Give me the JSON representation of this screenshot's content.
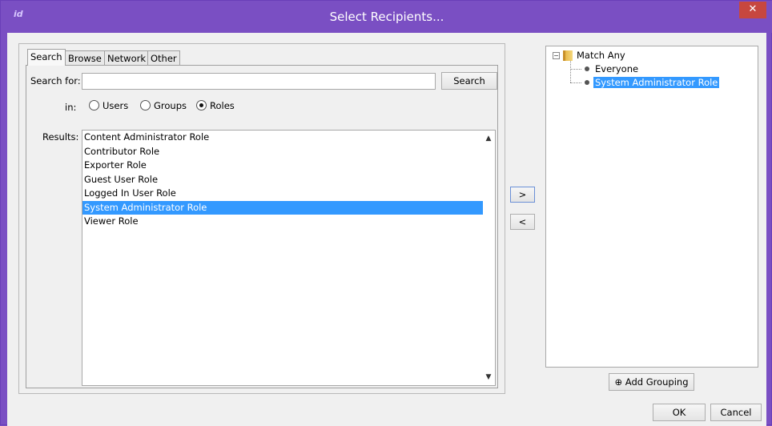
{
  "window": {
    "title": "Select Recipients...",
    "app_icon_glyph": "id",
    "close_glyph": "✕",
    "accent_color": "#7a4fc3",
    "close_color": "#c7473f"
  },
  "tabs": [
    "Search",
    "Browse",
    "Network",
    "Other"
  ],
  "search": {
    "label": "Search for:",
    "value": "",
    "button": "Search",
    "in_label": "in:",
    "options": [
      "Users",
      "Groups",
      "Roles"
    ],
    "selected_option": "Roles"
  },
  "results": {
    "label": "Results:",
    "items": [
      "Content Administrator Role",
      "Contributor Role",
      "Exporter Role",
      "Guest User Role",
      "Logged In User Role",
      "System Administrator Role",
      "Viewer Role"
    ],
    "selected": "System Administrator Role",
    "scroll_up_glyph": "▲",
    "scroll_down_glyph": "▼"
  },
  "transfer": {
    "add_label": ">",
    "remove_label": "<"
  },
  "tree": {
    "root": "Match Any",
    "children": [
      "Everyone",
      "System Administrator Role"
    ],
    "selected": "System Administrator Role",
    "expander_glyph": "−"
  },
  "add_grouping": {
    "icon": "⊕",
    "label": "Add Grouping"
  },
  "footer": {
    "ok": "OK",
    "cancel": "Cancel"
  }
}
